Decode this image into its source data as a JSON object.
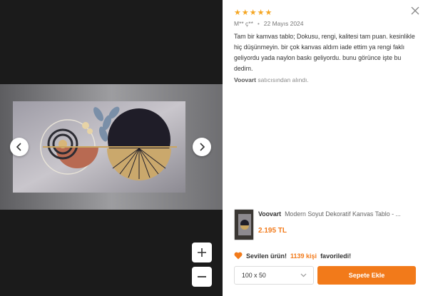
{
  "review": {
    "stars": [
      "★",
      "★",
      "★",
      "★",
      "★"
    ],
    "author": "M** ç**",
    "separator": "•",
    "date": "22 Mayıs 2024",
    "text": "Tam bir kamvas tablo; Dokusu, rengi, kalitesi tam puan. kesinlikle hiç düşünmeyin. bir çok kanvas aldım iade ettim ya rengi faklı geliyordu yada naylon baskı geliyordu. bunu görünce işte bu dedim.",
    "seller_name": "Voovart",
    "seller_suffix": "satıcısından alındı."
  },
  "product": {
    "brand": "Voovart",
    "name": "Modern Soyut Dekoratif Kanvas Tablo - ...",
    "price": "2.195 TL"
  },
  "favorite": {
    "icon": "heart-icon",
    "prefix": "Sevilen ürün!",
    "count_text": "1139 kişi",
    "suffix": "favoriledi!"
  },
  "size_select": {
    "value": "100 x 50"
  },
  "add_to_cart": {
    "label": "Sepete Ekle"
  },
  "colors": {
    "accent": "#f27a1a",
    "star": "#f5a623"
  }
}
